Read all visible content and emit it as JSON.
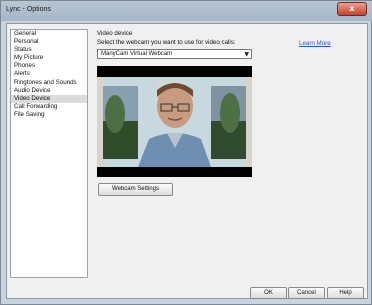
{
  "window": {
    "title": "Lync - Options",
    "close_glyph": "x",
    "accent": "#c4412b"
  },
  "nav": {
    "items": [
      {
        "label": "General",
        "selected": false
      },
      {
        "label": "Personal",
        "selected": false
      },
      {
        "label": "Status",
        "selected": false
      },
      {
        "label": "My Picture",
        "selected": false
      },
      {
        "label": "Phones",
        "selected": false
      },
      {
        "label": "Alerts",
        "selected": false
      },
      {
        "label": "Ringtones and Sounds",
        "selected": false
      },
      {
        "label": "Audio Device",
        "selected": false
      },
      {
        "label": "Video Device",
        "selected": true
      },
      {
        "label": "Call Forwarding",
        "selected": false
      },
      {
        "label": "File Saving",
        "selected": false
      }
    ]
  },
  "video": {
    "section_title": "Video device",
    "prompt": "Select the webcam you want to use for video calls:",
    "learn_more": "Learn More",
    "webcam_select_value": "ManyCam Virtual Webcam",
    "webcam_settings_label": "Webcam Settings"
  },
  "footer": {
    "ok_label": "OK",
    "cancel_label": "Cancel",
    "help_label": "Help"
  }
}
